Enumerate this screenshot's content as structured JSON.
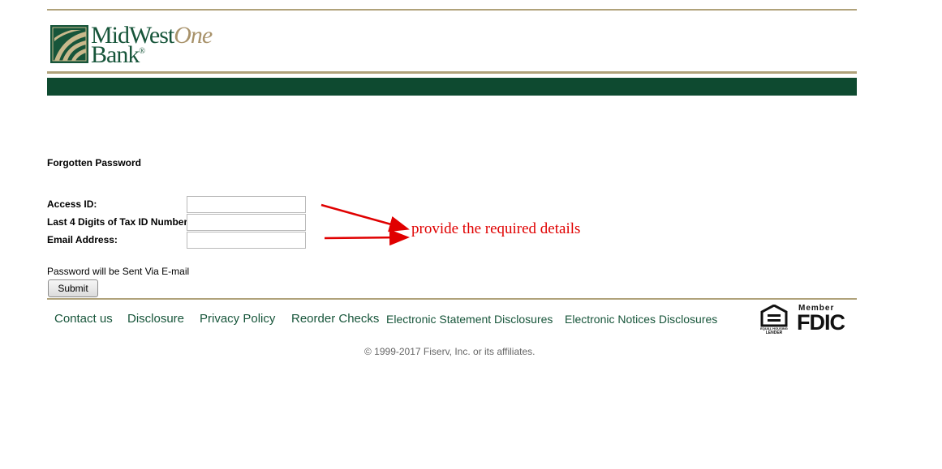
{
  "header": {
    "logo_line1": "MidWest",
    "logo_line1_accent": "One",
    "logo_line2": "Bank",
    "logo_reg": "®"
  },
  "form": {
    "heading": "Forgotten Password",
    "fields": [
      {
        "label": "Access ID:",
        "value": ""
      },
      {
        "label": "Last 4 Digits of Tax ID Number:",
        "value": ""
      },
      {
        "label": "Email Address:",
        "value": ""
      }
    ],
    "note": "Password will be Sent Via E-mail",
    "submit_label": "Submit"
  },
  "annotation": {
    "text": "provide the required details",
    "color": "#e00000"
  },
  "footer": {
    "links": [
      "Contact us",
      "Disclosure",
      "Privacy Policy",
      "Reorder Checks",
      "Electronic Statement Disclosures",
      "Electronic Notices Disclosures"
    ],
    "copyright": "© 1999-2017 Fiserv, Inc. or its affiliates.",
    "ehl_label": "EQUAL HOUSING LENDER",
    "fdic_member": "Member",
    "fdic_name": "FDIC"
  },
  "colors": {
    "brand_green": "#0e4a30",
    "brand_gold": "#b0a27a",
    "link_green": "#17553a"
  }
}
